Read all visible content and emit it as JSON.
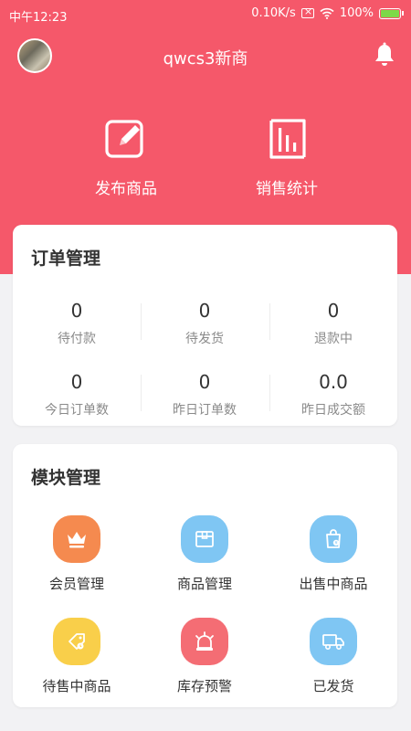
{
  "status_bar": {
    "time": "中午12:23",
    "speed": "0.10K/s",
    "battery": "100%"
  },
  "header": {
    "shop_name": "qwcs3新商"
  },
  "quick_actions": [
    {
      "label": "发布商品",
      "icon": "edit-icon"
    },
    {
      "label": "销售统计",
      "icon": "bar-chart-icon"
    }
  ],
  "orders": {
    "title": "订单管理",
    "stats": [
      {
        "value": "0",
        "label": "待付款"
      },
      {
        "value": "0",
        "label": "待发货"
      },
      {
        "value": "0",
        "label": "退款中"
      },
      {
        "value": "0",
        "label": "今日订单数"
      },
      {
        "value": "0",
        "label": "昨日订单数"
      },
      {
        "value": "0.0",
        "label": "昨日成交额"
      }
    ]
  },
  "modules": {
    "title": "模块管理",
    "items": [
      {
        "label": "会员管理",
        "icon": "crown-icon",
        "color": "#f58a4f"
      },
      {
        "label": "商品管理",
        "icon": "box-icon",
        "color": "#7fc6f3"
      },
      {
        "label": "出售中商品",
        "icon": "shopping-bag-icon",
        "color": "#7fc6f3"
      },
      {
        "label": "待售中商品",
        "icon": "tag-icon",
        "color": "#f9cf4a"
      },
      {
        "label": "库存预警",
        "icon": "alarm-icon",
        "color": "#f46d74"
      },
      {
        "label": "已发货",
        "icon": "truck-icon",
        "color": "#7fc6f3"
      }
    ]
  },
  "colors": {
    "brand": "#f5586a",
    "background": "#f2f2f4"
  }
}
